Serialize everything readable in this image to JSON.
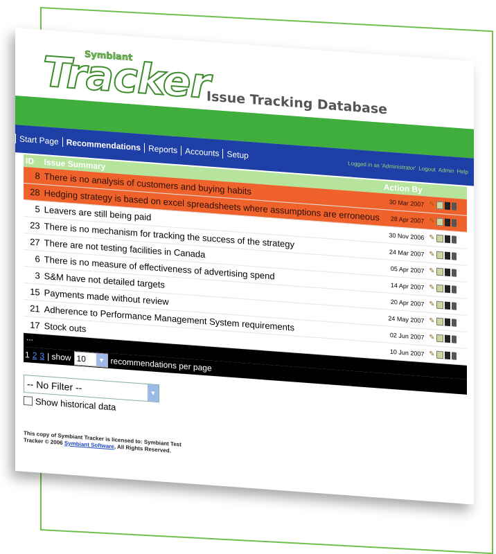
{
  "logo": {
    "brand": "Symbiant",
    "product": "Tracker"
  },
  "app_title": "Issue Tracking Database",
  "nav": {
    "items": [
      "Start Page",
      "Recommendations",
      "Reports",
      "Accounts",
      "Setup"
    ],
    "active": "Recommendations",
    "user_text": "Logged in as 'Administrator'",
    "links": [
      "Logout",
      "Admin",
      "Help"
    ]
  },
  "table": {
    "headers": {
      "id": "ID",
      "summary": "Issue Summary",
      "action": "Action By"
    },
    "rows": [
      {
        "id": "8",
        "summary": "There is no analysis of customers and buying habits",
        "date": "30 Mar 2007",
        "highlight": true
      },
      {
        "id": "28",
        "summary": "Hedging strategy is based on excel spreadsheets where assumptions are erroneous",
        "date": "28 Apr 2007",
        "highlight": true
      },
      {
        "id": "5",
        "summary": "Leavers are still being paid",
        "date": "30 Nov 2006",
        "highlight": false
      },
      {
        "id": "23",
        "summary": "There is no mechanism for tracking the success of the strategy",
        "date": "24 Mar 2007",
        "highlight": false
      },
      {
        "id": "27",
        "summary": "There are not testing facilities in Canada",
        "date": "05 Apr 2007",
        "highlight": false
      },
      {
        "id": "6",
        "summary": "There is no measure of effectiveness of advertising spend",
        "date": "14 Apr 2007",
        "highlight": false
      },
      {
        "id": "3",
        "summary": "S&M have not detailed targets",
        "date": "20 Apr 2007",
        "highlight": false
      },
      {
        "id": "15",
        "summary": "Payments made without review",
        "date": "24 May 2007",
        "highlight": false
      },
      {
        "id": "21",
        "summary": "Adherence to Performance Management System requirements",
        "date": "02 Jun 2007",
        "highlight": false
      },
      {
        "id": "17",
        "summary": "Stock outs",
        "date": "10 Jun 2007",
        "highlight": false
      }
    ]
  },
  "ellipsis": "...",
  "pager": {
    "current": "1",
    "pages": [
      "2",
      "3"
    ],
    "show_label": "| show",
    "per_page": "10",
    "suffix": "recommendations per page"
  },
  "filter": {
    "value": "-- No Filter --"
  },
  "historical": {
    "label": "Show historical data"
  },
  "footer": {
    "line1": "This copy of Symbiant Tracker is licensed to: Symbiant Test",
    "line2_prefix": "Tracker © 2006",
    "link": "Symbiant Software",
    "line2_suffix": ", All Rights Reserved."
  }
}
